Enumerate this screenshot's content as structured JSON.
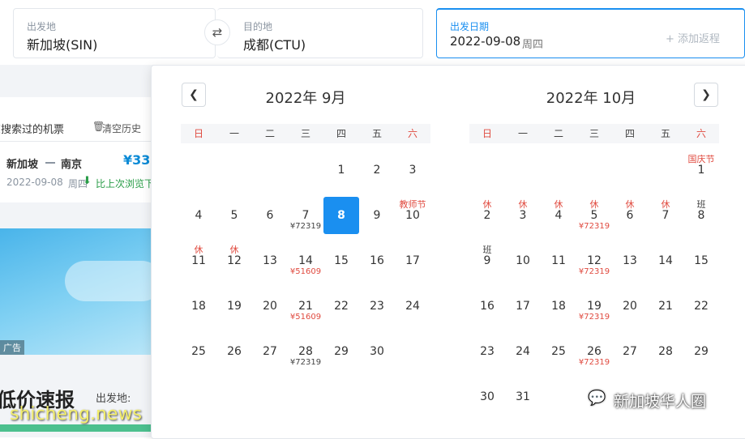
{
  "search": {
    "from_label": "出发地",
    "from_value": "新加坡(SIN)",
    "to_label": "目的地",
    "to_value": "成都(CTU)",
    "date_label": "出发日期",
    "date_value": "2022-09-08",
    "date_weekday": "周四",
    "add_return": "+ 添加返程"
  },
  "left": {
    "history_title": "您搜索过的机票",
    "clear_history": "清空历史",
    "trip_from": "新加坡",
    "trip_to": "南京",
    "trip_price": "¥33",
    "trip_date": "2022-09-08",
    "trip_weekday": "周四",
    "trip_note": "比上次浏览下",
    "ad_label": "广告",
    "deals_title": "低价速报",
    "deals_from_label": "出发地:"
  },
  "watermark": {
    "site": "shicheng.news",
    "wechat": "新加坡华人圈"
  },
  "calendar": {
    "weekdays": [
      "日",
      "一",
      "二",
      "三",
      "四",
      "五",
      "六"
    ],
    "months": [
      {
        "title": "2022年 9月",
        "days": [
          {
            "d": "1",
            "tag": "",
            "price": ""
          },
          {
            "d": "2",
            "tag": "",
            "price": ""
          },
          {
            "d": "3",
            "tag": "",
            "price": ""
          },
          {
            "d": "4",
            "tag": "",
            "price": ""
          },
          {
            "d": "5",
            "tag": "",
            "price": ""
          },
          {
            "d": "6",
            "tag": "",
            "price": ""
          },
          {
            "d": "7",
            "tag": "",
            "price": "¥72319",
            "price_red": false
          },
          {
            "d": "8",
            "tag": "",
            "price": "",
            "selected": true
          },
          {
            "d": "9",
            "tag": "",
            "price": ""
          },
          {
            "d": "10",
            "tag": "教师节",
            "price": ""
          },
          {
            "d": "11",
            "tag": "休",
            "price": ""
          },
          {
            "d": "12",
            "tag": "休",
            "price": ""
          },
          {
            "d": "13",
            "tag": "",
            "price": ""
          },
          {
            "d": "14",
            "tag": "",
            "price": "¥51609",
            "price_red": true
          },
          {
            "d": "15",
            "tag": "",
            "price": ""
          },
          {
            "d": "16",
            "tag": "",
            "price": ""
          },
          {
            "d": "17",
            "tag": "",
            "price": ""
          },
          {
            "d": "18",
            "tag": "",
            "price": ""
          },
          {
            "d": "19",
            "tag": "",
            "price": ""
          },
          {
            "d": "20",
            "tag": "",
            "price": ""
          },
          {
            "d": "21",
            "tag": "",
            "price": "¥51609",
            "price_red": true
          },
          {
            "d": "22",
            "tag": "",
            "price": ""
          },
          {
            "d": "23",
            "tag": "",
            "price": ""
          },
          {
            "d": "24",
            "tag": "",
            "price": ""
          },
          {
            "d": "25",
            "tag": "",
            "price": ""
          },
          {
            "d": "26",
            "tag": "",
            "price": ""
          },
          {
            "d": "27",
            "tag": "",
            "price": ""
          },
          {
            "d": "28",
            "tag": "",
            "price": "¥72319",
            "price_red": false
          },
          {
            "d": "29",
            "tag": "",
            "price": ""
          },
          {
            "d": "30",
            "tag": "",
            "price": ""
          }
        ]
      },
      {
        "title": "2022年 10月",
        "days": [
          {
            "d": "1",
            "tag": "国庆节",
            "price": ""
          },
          {
            "d": "2",
            "tag": "休",
            "price": ""
          },
          {
            "d": "3",
            "tag": "休",
            "price": ""
          },
          {
            "d": "4",
            "tag": "休",
            "price": ""
          },
          {
            "d": "5",
            "tag": "休",
            "price": "¥72319",
            "price_red": true
          },
          {
            "d": "6",
            "tag": "休",
            "price": ""
          },
          {
            "d": "7",
            "tag": "休",
            "price": ""
          },
          {
            "d": "8",
            "tag": "班",
            "tag_black": true,
            "price": ""
          },
          {
            "d": "9",
            "tag": "班",
            "tag_black": true,
            "price": ""
          },
          {
            "d": "10",
            "tag": "",
            "price": ""
          },
          {
            "d": "11",
            "tag": "",
            "price": ""
          },
          {
            "d": "12",
            "tag": "",
            "price": "¥72319",
            "price_red": true
          },
          {
            "d": "13",
            "tag": "",
            "price": ""
          },
          {
            "d": "14",
            "tag": "",
            "price": ""
          },
          {
            "d": "15",
            "tag": "",
            "price": ""
          },
          {
            "d": "16",
            "tag": "",
            "price": ""
          },
          {
            "d": "17",
            "tag": "",
            "price": ""
          },
          {
            "d": "18",
            "tag": "",
            "price": ""
          },
          {
            "d": "19",
            "tag": "",
            "price": "¥72319",
            "price_red": true
          },
          {
            "d": "20",
            "tag": "",
            "price": ""
          },
          {
            "d": "21",
            "tag": "",
            "price": ""
          },
          {
            "d": "22",
            "tag": "",
            "price": ""
          },
          {
            "d": "23",
            "tag": "",
            "price": ""
          },
          {
            "d": "24",
            "tag": "",
            "price": ""
          },
          {
            "d": "25",
            "tag": "",
            "price": ""
          },
          {
            "d": "26",
            "tag": "",
            "price": "¥72319",
            "price_red": true
          },
          {
            "d": "27",
            "tag": "",
            "price": ""
          },
          {
            "d": "28",
            "tag": "",
            "price": ""
          },
          {
            "d": "29",
            "tag": "",
            "price": ""
          },
          {
            "d": "30",
            "tag": "",
            "price": ""
          },
          {
            "d": "31",
            "tag": "",
            "price": ""
          }
        ]
      }
    ]
  },
  "colors": {
    "accent": "#1a8ff0",
    "holiday_red": "#e04a3f",
    "price_teal": "#0a8ad6",
    "note_green": "#2a9d48"
  }
}
